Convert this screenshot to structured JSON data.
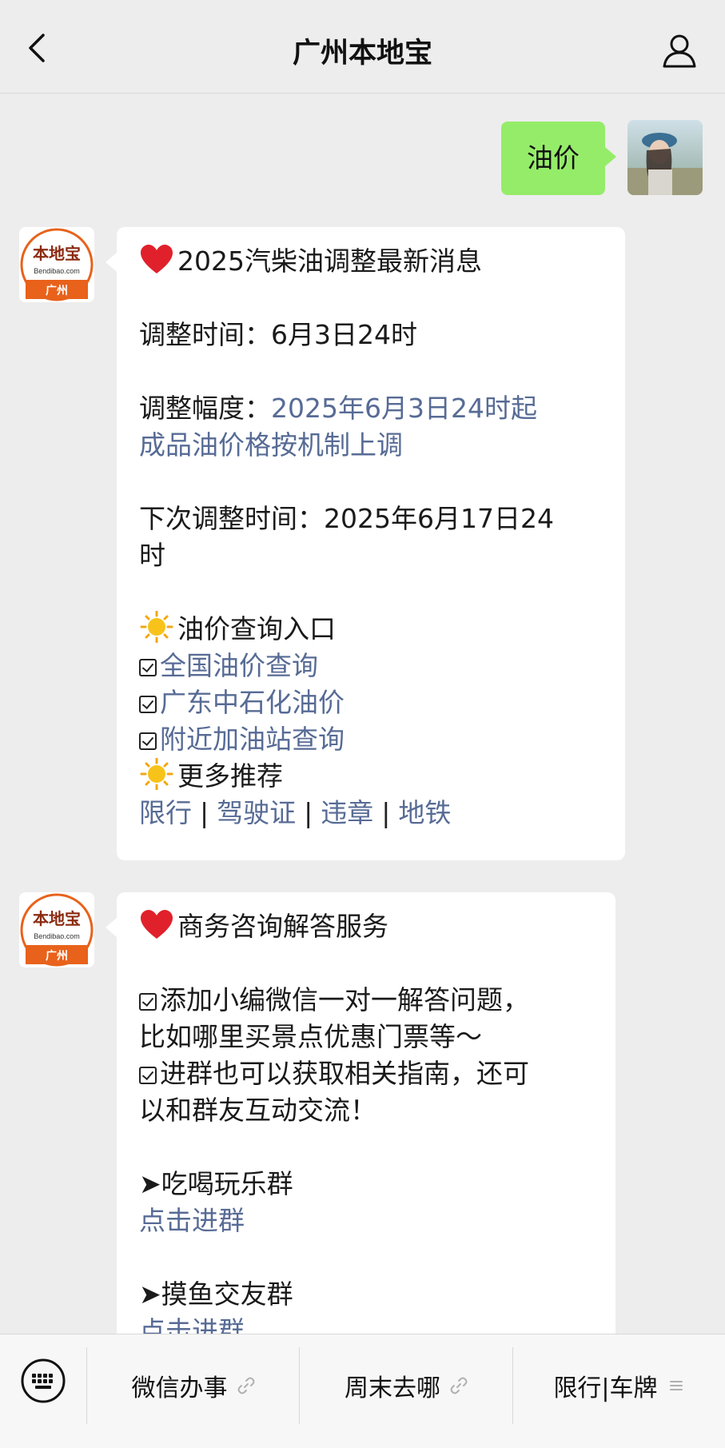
{
  "header": {
    "title": "广州本地宝"
  },
  "outgoing": {
    "text": "油价"
  },
  "message1": {
    "title": "2025汽柴油调整最新消息",
    "adjust_time_label": "调整时间：",
    "adjust_time_value": "6月3日24时",
    "range_label": "调整幅度：",
    "range_value_line1": "2025年6月3日24时起",
    "range_value_line2": "成品油价格按机制上调",
    "next_label": "下次调整时间：",
    "next_value_line1": "2025年6月17日24",
    "next_value_line2": "时",
    "query_heading": "油价查询入口",
    "links": [
      "全国油价查询",
      "广东中石化油价",
      "附近加油站查询"
    ],
    "more_heading": "更多推荐",
    "recommend": [
      "限行",
      "驾驶证",
      "违章",
      "地铁"
    ],
    "separator": "|"
  },
  "message2": {
    "title": "商务咨询解答服务",
    "para1_line1": "添加小编微信一对一解答问题，",
    "para1_line2": "比如哪里买景点优惠门票等～",
    "para2_line1": "进群也可以获取相关指南，还可",
    "para2_line2": "以和群友互动交流！",
    "group1": "➤吃喝玩乐群",
    "group1_link": "点击进群",
    "group2": "➤摸鱼交友群",
    "group2_link": "点击进群"
  },
  "bot_avatar": {
    "brand": "本地宝",
    "domain": "Bendibao.com",
    "city": "广州"
  },
  "bottom_menu": [
    {
      "label": "微信办事",
      "icon": "link-icon"
    },
    {
      "label": "周末去哪",
      "icon": "link-icon"
    },
    {
      "label": "限行|车牌",
      "icon": "menu-lines-icon"
    }
  ],
  "colors": {
    "bubble_green": "#95ec69",
    "link": "#576b95",
    "brand_orange": "#e8621b"
  }
}
